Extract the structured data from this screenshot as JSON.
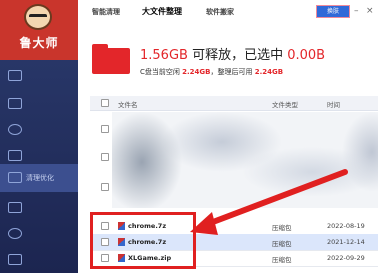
{
  "app": {
    "logo_text": "鲁大师"
  },
  "topbar": {
    "tabs": [
      {
        "label": "智能清理"
      },
      {
        "label": "大文件整理"
      },
      {
        "label": "软件搬家"
      }
    ],
    "skin_label": "换肤"
  },
  "sidebar": {
    "active_label": "清理优化"
  },
  "summary": {
    "size": "1.56GB",
    "releasable_label": "可释放，已选中",
    "selected": "0.00B",
    "disk_label": "C盘当前空闲",
    "disk_free": "2.24GB",
    "after_label": "，整理后可用",
    "after_free": "2.24GB"
  },
  "table": {
    "headers": [
      "文件名",
      "文件类型",
      "时间"
    ],
    "rows": [
      {
        "name": "chrome.7z",
        "type": "压缩包",
        "date": "2022-08-19",
        "selected": false
      },
      {
        "name": "chrome.7z",
        "type": "压缩包",
        "date": "2021-12-14",
        "selected": true
      },
      {
        "name": "XLGame.zip",
        "type": "压缩包",
        "date": "2022-09-29",
        "selected": false
      }
    ]
  },
  "colors": {
    "accent": "#e3262a",
    "sidebar": "#2b3b6e",
    "selected_row": "#dbe6fb"
  }
}
